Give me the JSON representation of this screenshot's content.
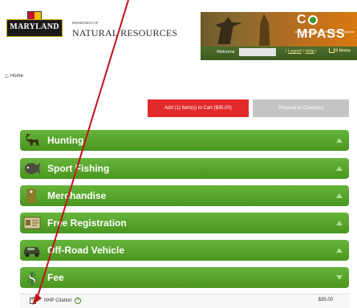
{
  "header": {
    "logo_text": "MARYLAND",
    "dept_small": "DEPARTMENT OF",
    "dept_big": "NATURAL RESOURCES",
    "brand": {
      "pre": "C",
      "post": "MPASS",
      "tagline": "Online Licensing and Registration System"
    },
    "welcome": "Welcome",
    "links": [
      "Logout",
      "Help"
    ],
    "cart_label": "0 Items"
  },
  "breadcrumb": {
    "home": "Home"
  },
  "buttons": {
    "add_to_cart": "Add (1) Item(s) to Cart ($35.00)",
    "checkout": "Proceed to Checkout"
  },
  "categories": [
    {
      "label": "Hunting",
      "icon": "deer-icon",
      "expanded": false
    },
    {
      "label": "Sport Fishing",
      "icon": "fish-icon",
      "expanded": false
    },
    {
      "label": "Merchandise",
      "icon": "tag-icon",
      "expanded": false
    },
    {
      "label": "Free Registration",
      "icon": "card-icon",
      "expanded": false
    },
    {
      "label": "Off-Road Vehicle",
      "icon": "jeep-icon",
      "expanded": false
    },
    {
      "label": "Fee",
      "icon": "dollar-icon",
      "expanded": true
    }
  ],
  "fee_item": {
    "label": "NHP Citation",
    "price": "$35.00",
    "checked": true
  },
  "colors": {
    "green": "#5aa62e",
    "red_button": "#e32a2a",
    "gray_button": "#c4c4c4",
    "annotation_arrow": "#c0121a"
  }
}
